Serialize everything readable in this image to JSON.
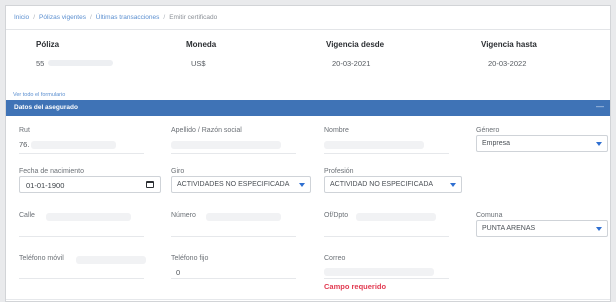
{
  "breadcrumb": [
    "Inicio",
    "Pólizas vigentes",
    "Últimas transacciones",
    "Emitir certificado"
  ],
  "policy": {
    "headers": [
      "Póliza",
      "Moneda",
      "Vigencia desde",
      "Vigencia hasta"
    ],
    "values": [
      "55",
      "US$",
      "20-03-2021",
      "20-03-2022"
    ]
  },
  "form_link": "Ver todo el formulario",
  "section_title": "Datos del asegurado",
  "fields": {
    "rut_label": "Rut",
    "rut_value": "76.",
    "apellido_label": "Apellido / Razón social",
    "nombre_label": "Nombre",
    "genero_label": "Género",
    "genero_value": "Empresa",
    "fecha_label": "Fecha de nacimiento",
    "fecha_value": "01-01-1900",
    "giro_label": "Giro",
    "giro_value": "ACTIVIDADES NO ESPECIFICADA",
    "profesion_label": "Profesión",
    "profesion_value": "ACTIVIDAD NO ESPECIFICADA",
    "calle_label": "Calle",
    "numero_label": "Número",
    "ofdpto_label": "Of/Dpto",
    "comuna_label": "Comuna",
    "comuna_value": "PUNTA ARENAS",
    "tel_movil_label": "Teléfono móvil",
    "tel_fijo_label": "Teléfono fijo",
    "tel_fijo_value": "0",
    "correo_label": "Correo",
    "correo_error": "Campo requerido"
  },
  "colors": {
    "section_bg": "#3f73b6",
    "link": "#5b8fd0",
    "error": "#e23b52",
    "caret": "#2f6fd1"
  }
}
